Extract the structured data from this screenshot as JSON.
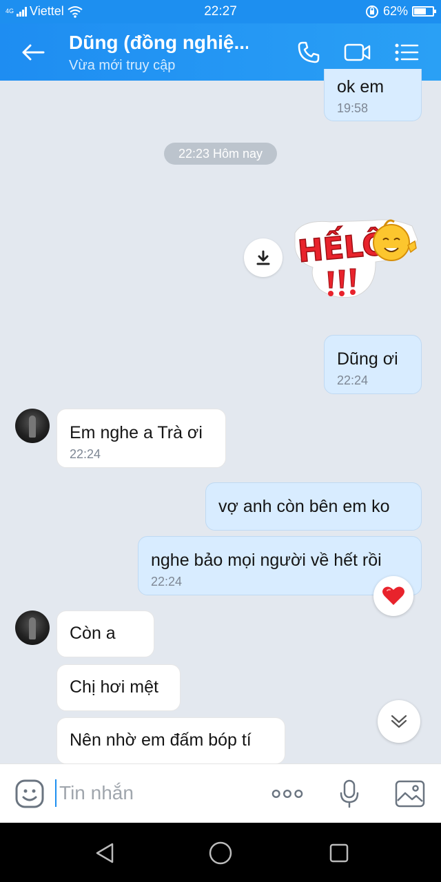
{
  "status_bar": {
    "network": "4G",
    "carrier": "Viettel",
    "time": "22:27",
    "battery": "62%",
    "battery_level": 0.62
  },
  "header": {
    "title": "Dũng (đồng nghiệ...",
    "subtitle": "Vừa mới truy cập"
  },
  "chat": {
    "date_separator": "22:23 Hôm nay",
    "messages": [
      {
        "direction": "out",
        "text": "ok em",
        "time": "19:58"
      },
      {
        "direction": "out",
        "type": "sticker",
        "sticker_text": "HẾLÔ"
      },
      {
        "direction": "out",
        "text": "Dũng ơi",
        "time": "22:24"
      },
      {
        "direction": "in",
        "text": "Em nghe a Trà ơi",
        "time": "22:24"
      },
      {
        "direction": "out",
        "text": "vợ anh còn bên em ko"
      },
      {
        "direction": "out",
        "text": "nghe bảo mọi người về hết rồi",
        "time": "22:24"
      },
      {
        "direction": "in",
        "text": "Còn a"
      },
      {
        "direction": "in",
        "text": "Chị hơi mệt"
      },
      {
        "direction": "in",
        "text": "Nên nhờ em đấm bóp tí"
      }
    ]
  },
  "input": {
    "placeholder": "Tin nhắn"
  },
  "colors": {
    "header": "#1e8df2",
    "outgoing_bubble": "#d8ecff",
    "incoming_bubble": "#ffffff",
    "background": "#e3e8ef"
  }
}
